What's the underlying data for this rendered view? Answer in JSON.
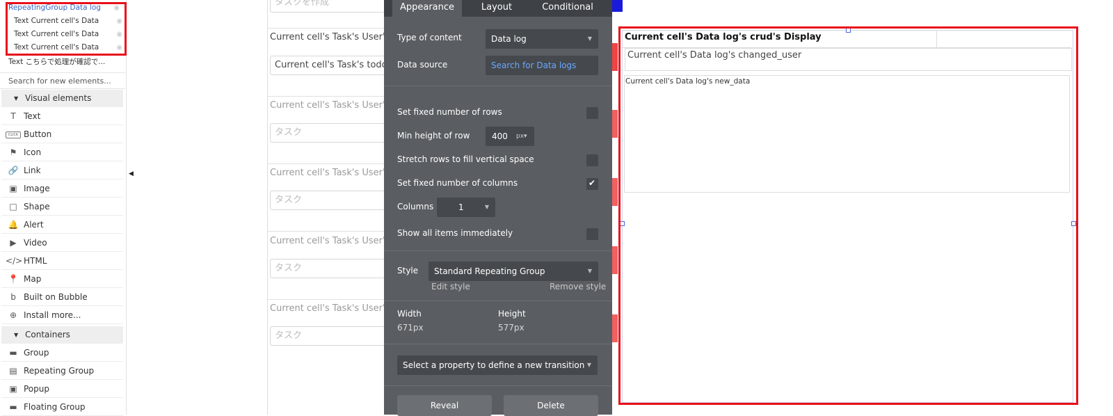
{
  "sidebar": {
    "tree": {
      "parent": "RepeatingGroup Data log",
      "children": [
        "Text Current cell's Data",
        "Text Current cell's Data",
        "Text Current cell's Data"
      ],
      "extra": "Text こちらで処理が確認で..."
    },
    "search_placeholder": "Search for new elements...",
    "visual_header": "Visual elements",
    "visual_items": [
      {
        "icon": "text-icon",
        "glyph": "T",
        "label": "Text"
      },
      {
        "icon": "button-icon",
        "glyph": "CLICK",
        "label": "Button"
      },
      {
        "icon": "flag-icon",
        "glyph": "⚑",
        "label": "Icon"
      },
      {
        "icon": "link-icon",
        "glyph": "🔗",
        "label": "Link"
      },
      {
        "icon": "image-icon",
        "glyph": "▣",
        "label": "Image"
      },
      {
        "icon": "shape-icon",
        "glyph": "□",
        "label": "Shape"
      },
      {
        "icon": "bell-icon",
        "glyph": "🔔",
        "label": "Alert"
      },
      {
        "icon": "video-icon",
        "glyph": "▶",
        "label": "Video"
      },
      {
        "icon": "html-icon",
        "glyph": "</>",
        "label": "HTML"
      },
      {
        "icon": "map-pin-icon",
        "glyph": "📍",
        "label": "Map"
      },
      {
        "icon": "bubble-icon",
        "glyph": "b",
        "label": "Built on Bubble"
      },
      {
        "icon": "plus-circle-icon",
        "glyph": "⊕",
        "label": "Install more..."
      }
    ],
    "containers_header": "Containers",
    "container_items": [
      {
        "icon": "folder-icon",
        "glyph": "▬",
        "label": "Group"
      },
      {
        "icon": "repeating-group-icon",
        "glyph": "▤",
        "label": "Repeating Group"
      },
      {
        "icon": "popup-icon",
        "glyph": "▣",
        "label": "Popup"
      },
      {
        "icon": "floating-group-icon",
        "glyph": "▬",
        "label": "Floating Group"
      }
    ]
  },
  "canvas": {
    "top_input": "タスクを作成",
    "rows": [
      {
        "label": "Current cell's Task's User's",
        "input": "Current cell's Task's todo"
      },
      {
        "label": "Current cell's Task's User's",
        "input": "タスク"
      },
      {
        "label": "Current cell's Task's User's",
        "input": "タスク"
      },
      {
        "label": "Current cell's Task's User's",
        "input": "タスク"
      },
      {
        "label": "Current cell's Task's User's",
        "input": "タスク"
      }
    ]
  },
  "editor": {
    "tabs": [
      "Appearance",
      "Layout",
      "Conditional"
    ],
    "type_of_content_label": "Type of content",
    "type_of_content_value": "Data log",
    "data_source_label": "Data source",
    "data_source_value": "Search for Data logs",
    "fixed_rows_label": "Set fixed number of rows",
    "fixed_rows_checked": false,
    "min_height_label": "Min height of row",
    "min_height_value": "400",
    "min_height_unit": "px",
    "stretch_label": "Stretch rows to fill vertical space",
    "stretch_checked": false,
    "fixed_cols_label": "Set fixed number of columns",
    "fixed_cols_checked": true,
    "columns_label": "Columns",
    "columns_value": "1",
    "show_all_label": "Show all items immediately",
    "show_all_checked": false,
    "style_label": "Style",
    "style_value": "Standard Repeating Group",
    "edit_style": "Edit style",
    "remove_style": "Remove style",
    "width_label": "Width",
    "width_value": "671px",
    "height_label": "Height",
    "height_value": "577px",
    "transition_placeholder": "Select a property to define a new transition",
    "bottom_buttons": [
      "Reveal",
      "Delete"
    ]
  },
  "preview": {
    "title": "Current cell's Data log's crud's Display",
    "changed_user": "Current cell's Data log's changed_user",
    "new_data": "Current cell's Data log's new_data"
  },
  "colors": {
    "selection_red": "#e8101a",
    "editor_bg": "#5a5e62",
    "editor_tab_bg": "#3e4246",
    "link_blue": "#6aa7ff"
  }
}
